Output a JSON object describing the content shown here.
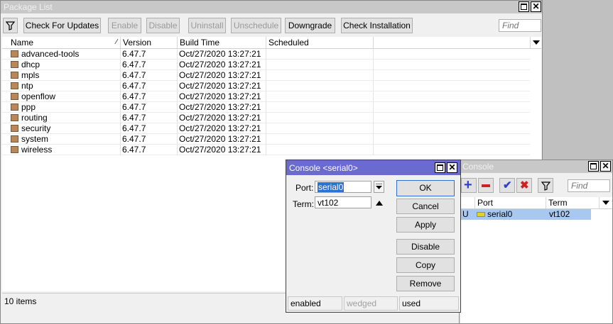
{
  "package_window": {
    "title": "Package List",
    "toolbar": {
      "filter_icon": "filter-icon",
      "check_updates": "Check For Updates",
      "enable": "Enable",
      "disable": "Disable",
      "uninstall": "Uninstall",
      "unschedule": "Unschedule",
      "downgrade": "Downgrade",
      "check_installation": "Check Installation",
      "find_placeholder": "Find"
    },
    "columns": [
      "Name",
      "Version",
      "Build Time",
      "Scheduled"
    ],
    "rows": [
      {
        "name": "advanced-tools",
        "version": "6.47.7",
        "build": "Oct/27/2020 13:27:21",
        "scheduled": ""
      },
      {
        "name": "dhcp",
        "version": "6.47.7",
        "build": "Oct/27/2020 13:27:21",
        "scheduled": ""
      },
      {
        "name": "mpls",
        "version": "6.47.7",
        "build": "Oct/27/2020 13:27:21",
        "scheduled": ""
      },
      {
        "name": "ntp",
        "version": "6.47.7",
        "build": "Oct/27/2020 13:27:21",
        "scheduled": ""
      },
      {
        "name": "openflow",
        "version": "6.47.7",
        "build": "Oct/27/2020 13:27:21",
        "scheduled": ""
      },
      {
        "name": "ppp",
        "version": "6.47.7",
        "build": "Oct/27/2020 13:27:21",
        "scheduled": ""
      },
      {
        "name": "routing",
        "version": "6.47.7",
        "build": "Oct/27/2020 13:27:21",
        "scheduled": ""
      },
      {
        "name": "security",
        "version": "6.47.7",
        "build": "Oct/27/2020 13:27:21",
        "scheduled": ""
      },
      {
        "name": "system",
        "version": "6.47.7",
        "build": "Oct/27/2020 13:27:21",
        "scheduled": ""
      },
      {
        "name": "wireless",
        "version": "6.47.7",
        "build": "Oct/27/2020 13:27:21",
        "scheduled": ""
      }
    ],
    "status": "10 items"
  },
  "console_list_window": {
    "title": "Console",
    "find_placeholder": "Find",
    "columns": [
      "Port",
      "Term"
    ],
    "rows": [
      {
        "flag": "U",
        "port": "serial0",
        "term": "vt102"
      }
    ],
    "colors": {
      "selected_row": "#a8c8f0",
      "add": "#2f3fd0",
      "remove": "#d02020",
      "check": "#2f3fd0",
      "cross": "#d02020"
    }
  },
  "console_dialog": {
    "title": "Console <serial0>",
    "port_label": "Port:",
    "port_value": "serial0",
    "term_label": "Term:",
    "term_value": "vt102",
    "buttons": {
      "ok": "OK",
      "cancel": "Cancel",
      "apply": "Apply",
      "disable": "Disable",
      "copy": "Copy",
      "remove": "Remove"
    },
    "status": [
      "enabled",
      "wedged",
      "used"
    ],
    "colors": {
      "title_bg": "#6a6ad0",
      "port_selected": "#3070d0"
    }
  }
}
